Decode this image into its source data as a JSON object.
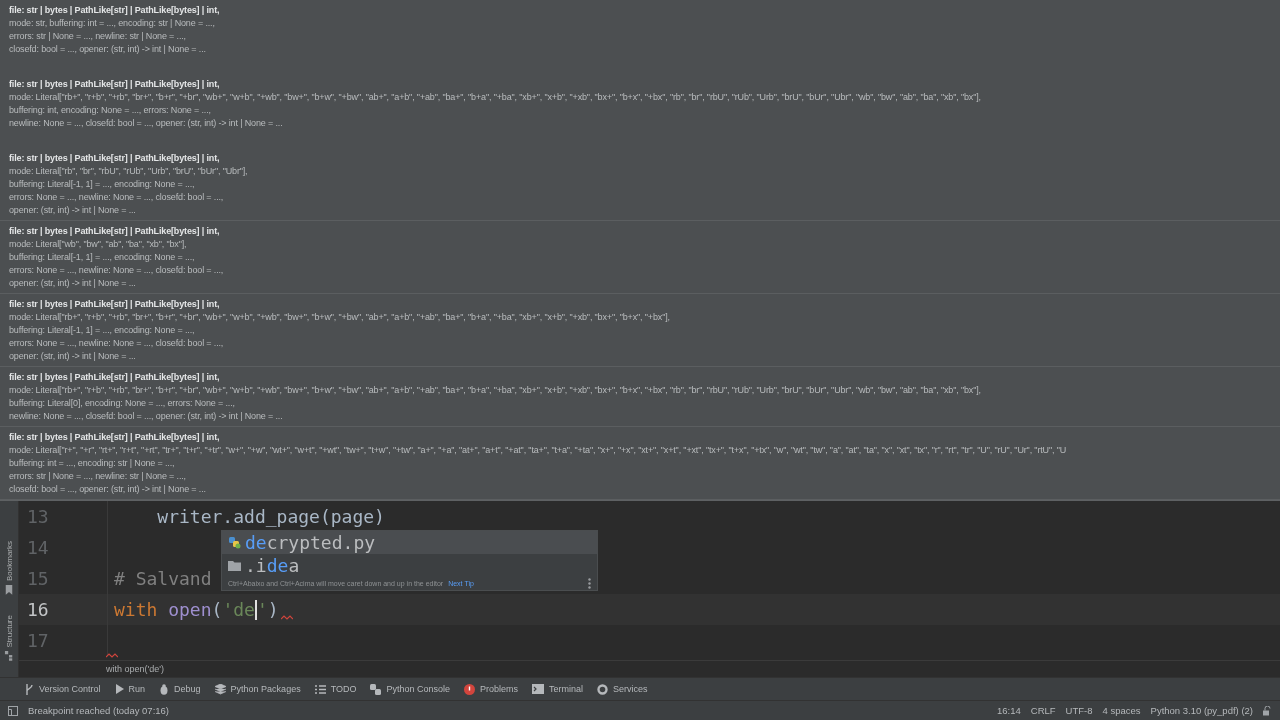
{
  "signatures": [
    {
      "lines": [
        "file: str | bytes | PathLike[str] | PathLike[bytes] | int,",
        "mode: str, buffering: int = ..., encoding: str | None = ...,",
        "errors: str | None = ..., newline: str | None = ...,",
        "closefd: bool = ..., opener: (str, int) -> int | None = ..."
      ]
    },
    {
      "lines": [
        "file: str | bytes | PathLike[str] | PathLike[bytes] | int,",
        "mode: Literal[\"rb+\", \"r+b\", \"+rb\", \"br+\", \"b+r\", \"+br\", \"wb+\", \"w+b\", \"+wb\", \"bw+\", \"b+w\", \"+bw\", \"ab+\", \"a+b\", \"+ab\", \"ba+\", \"b+a\", \"+ba\", \"xb+\", \"x+b\", \"+xb\", \"bx+\", \"b+x\", \"+bx\", \"rb\", \"br\", \"rbU\", \"rUb\", \"Urb\", \"brU\", \"bUr\", \"Ubr\", \"wb\", \"bw\", \"ab\", \"ba\", \"xb\", \"bx\"],",
        "buffering: int, encoding: None = ..., errors: None = ...,",
        "newline: None = ..., closefd: bool = ..., opener: (str, int) -> int | None = ..."
      ]
    },
    {
      "lines": [
        "file: str | bytes | PathLike[str] | PathLike[bytes] | int,",
        "mode: Literal[\"rb\", \"br\", \"rbU\", \"rUb\", \"Urb\", \"brU\", \"bUr\", \"Ubr\"],",
        "buffering: Literal[-1, 1] = ..., encoding: None = ...,",
        "errors: None = ..., newline: None = ..., closefd: bool = ...,",
        "opener: (str, int) -> int | None = ..."
      ]
    },
    {
      "lines": [
        "file: str | bytes | PathLike[str] | PathLike[bytes] | int,",
        "mode: Literal[\"wb\", \"bw\", \"ab\", \"ba\", \"xb\", \"bx\"],",
        "buffering: Literal[-1, 1] = ..., encoding: None = ...,",
        "errors: None = ..., newline: None = ..., closefd: bool = ...,",
        "opener: (str, int) -> int | None = ..."
      ]
    },
    {
      "lines": [
        "file: str | bytes | PathLike[str] | PathLike[bytes] | int,",
        "mode: Literal[\"rb+\", \"r+b\", \"+rb\", \"br+\", \"b+r\", \"+br\", \"wb+\", \"w+b\", \"+wb\", \"bw+\", \"b+w\", \"+bw\", \"ab+\", \"a+b\", \"+ab\", \"ba+\", \"b+a\", \"+ba\", \"xb+\", \"x+b\", \"+xb\", \"bx+\", \"b+x\", \"+bx\"],",
        "buffering: Literal[-1, 1] = ..., encoding: None = ...,",
        "errors: None = ..., newline: None = ..., closefd: bool = ...,",
        "opener: (str, int) -> int | None = ..."
      ]
    },
    {
      "lines": [
        "file: str | bytes | PathLike[str] | PathLike[bytes] | int,",
        "mode: Literal[\"rb+\", \"r+b\", \"+rb\", \"br+\", \"b+r\", \"+br\", \"wb+\", \"w+b\", \"+wb\", \"bw+\", \"b+w\", \"+bw\", \"ab+\", \"a+b\", \"+ab\", \"ba+\", \"b+a\", \"+ba\", \"xb+\", \"x+b\", \"+xb\", \"bx+\", \"b+x\", \"+bx\", \"rb\", \"br\", \"rbU\", \"rUb\", \"Urb\", \"brU\", \"bUr\", \"Ubr\", \"wb\", \"bw\", \"ab\", \"ba\", \"xb\", \"bx\"],",
        "buffering: Literal[0], encoding: None = ..., errors: None = ...,",
        "newline: None = ..., closefd: bool = ..., opener: (str, int) -> int | None = ..."
      ]
    },
    {
      "lines": [
        "file: str | bytes | PathLike[str] | PathLike[bytes] | int,",
        "mode: Literal[\"r+\", \"+r\", \"rt+\", \"r+t\", \"+rt\", \"tr+\", \"t+r\", \"+tr\", \"w+\", \"+w\", \"wt+\", \"w+t\", \"+wt\", \"tw+\", \"t+w\", \"+tw\", \"a+\", \"+a\", \"at+\", \"a+t\", \"+at\", \"ta+\", \"t+a\", \"+ta\", \"x+\", \"+x\", \"xt+\", \"x+t\", \"+xt\", \"tx+\", \"t+x\", \"+tx\", \"w\", \"wt\", \"tw\", \"a\", \"at\", \"ta\", \"x\", \"xt\", \"tx\", \"r\", \"rt\", \"tr\", \"U\", \"rU\", \"Ur\", \"rtU\", \"U",
        "buffering: int = ..., encoding: str | None = ...,",
        "errors: str | None = ..., newline: str | None = ...,",
        "closefd: bool = ..., opener: (str, int) -> int | None = ..."
      ]
    }
  ],
  "left_strip": [
    "Bookmarks",
    "Structure"
  ],
  "editor": {
    "lines": [
      {
        "number": "13",
        "current": false,
        "tokens": [
          {
            "kind": "plain",
            "text": "    writer.add_page(page)"
          }
        ]
      },
      {
        "number": "14",
        "current": false
      },
      {
        "number": "15",
        "current": false,
        "tokens": [
          {
            "kind": "comment",
            "text": "# Salvand"
          }
        ]
      },
      {
        "number": "16",
        "current": true,
        "tokens": [
          {
            "kind": "keyword",
            "text": "with"
          },
          {
            "kind": "function",
            "text": "open"
          },
          {
            "kind": "plain",
            "text": "("
          },
          {
            "kind": "string",
            "text": "'de"
          },
          {
            "kind": "caret"
          },
          {
            "kind": "string",
            "text": "'"
          },
          {
            "kind": "plain",
            "text": ")"
          },
          {
            "kind": "squiggle"
          }
        ]
      },
      {
        "number": "17",
        "current": false
      }
    ],
    "breadcrumb": "with open('de')"
  },
  "completion": {
    "items": [
      {
        "kind": "python-file",
        "match": "de",
        "after": "crypted.py",
        "selected": true
      },
      {
        "kind": "folder",
        "before": ".i",
        "match": "de",
        "after": "a",
        "selected": false
      }
    ],
    "hint": "Ctrl+Abaixo and Ctrl+Acima will move caret down and up in the editor",
    "next_tip": "Next Tip"
  },
  "tool_windows": [
    {
      "kind": "vcs",
      "label": "Version Control"
    },
    {
      "kind": "run",
      "label": "Run"
    },
    {
      "kind": "debug",
      "label": "Debug"
    },
    {
      "kind": "packages",
      "label": "Python Packages"
    },
    {
      "kind": "todo",
      "label": "TODO"
    },
    {
      "kind": "console",
      "label": "Python Console"
    },
    {
      "kind": "problems",
      "label": "Problems"
    },
    {
      "kind": "terminal",
      "label": "Terminal"
    },
    {
      "kind": "services",
      "label": "Services"
    }
  ],
  "status_bar": {
    "message": "Breakpoint reached (today 07:16)",
    "items": [
      "16:14",
      "CRLF",
      "UTF-8",
      "4 spaces",
      "Python 3.10 (py_pdf) (2)"
    ]
  }
}
